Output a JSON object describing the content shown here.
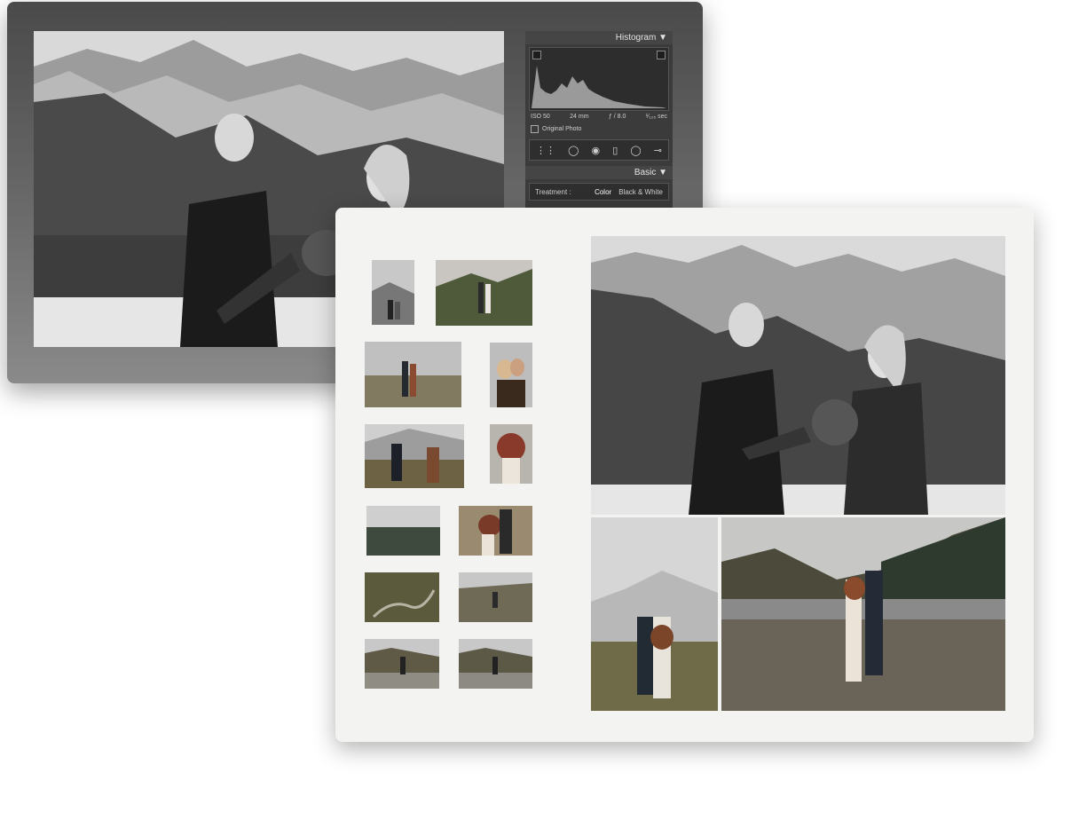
{
  "develop_panel": {
    "histogram_title": "Histogram ▼",
    "exif": {
      "iso": "ISO 50",
      "focal": "24 mm",
      "aperture": "ƒ / 8.0",
      "shutter": "¹⁄₁₂₅ sec"
    },
    "original_photo_label": "Original Photo",
    "basic_title": "Basic ▼",
    "treatment": {
      "label": "Treatment :",
      "color": "Color",
      "bw": "Black & White"
    }
  },
  "icons": [
    "crop-overlay-icon",
    "spot-removal-icon",
    "red-eye-icon",
    "graduated-filter-icon",
    "radial-filter-icon",
    "adjustment-brush-icon",
    "histogram-clip-shadow-icon",
    "histogram-clip-highlight-icon",
    "triangle-down-icon"
  ],
  "colors": {
    "editor_bg": "#5e5e5e",
    "panel_bg": "#3b3b3b",
    "book_bg": "#f3f3f1"
  }
}
